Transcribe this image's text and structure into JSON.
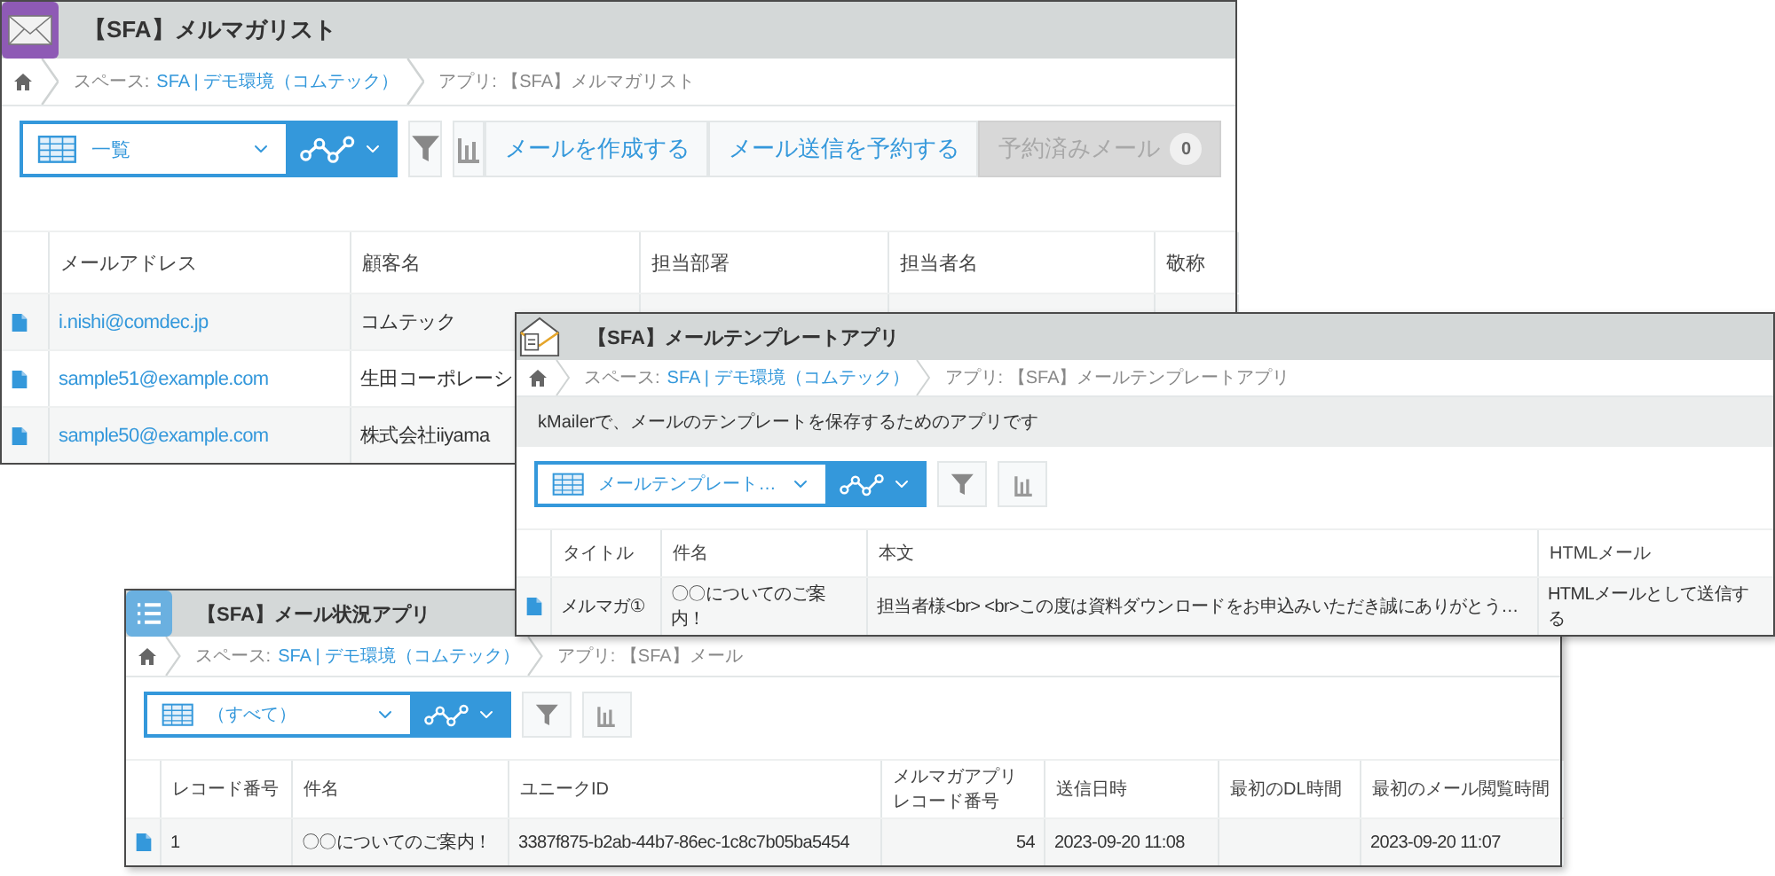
{
  "windows": [
    {
      "title": "【SFA】メルマガリスト",
      "breadcrumb": {
        "space_label": "スペース:",
        "space": "SFA | デモ環境（コムテック）",
        "app": "アプリ: 【SFA】メルマガリスト"
      },
      "view": "一覧",
      "buttons": [
        {
          "label": "メールを作成する",
          "disabled": false
        },
        {
          "label": "メール送信を予約する",
          "disabled": false
        },
        {
          "label": "予約済みメール",
          "count": "0",
          "disabled": true
        }
      ],
      "table": {
        "columns": [
          {
            "label": "メールアドレス",
            "kind": "link"
          },
          {
            "label": "顧客名",
            "kind": "text"
          },
          {
            "label": "担当部署",
            "kind": "text"
          },
          {
            "label": "担当者名",
            "kind": "text"
          },
          {
            "label": "敬称",
            "kind": "text"
          }
        ],
        "rows": [
          {
            "cells": [
              "i.nishi@comdec.jp",
              "コムテック"
            ]
          },
          {
            "cells": [
              "sample51@example.com",
              "生田コーポレーシ"
            ]
          },
          {
            "cells": [
              "sample50@example.com",
              "株式会社iiyama"
            ]
          }
        ]
      }
    },
    {
      "title": "【SFA】メールテンプレートアプリ",
      "breadcrumb": {
        "space_label": "スペース:",
        "space": "SFA | デモ環境（コムテック）",
        "app": "アプリ: 【SFA】メールテンプレートアプリ"
      },
      "description": "kMailerで、メールのテンプレートを保存するためのアプリです",
      "view": "メールテンプレート…",
      "table": {
        "columns": [
          {
            "label": "タイトル",
            "kind": "text"
          },
          {
            "label": "件名",
            "kind": "text"
          },
          {
            "label": "本文",
            "kind": "text"
          },
          {
            "label": "HTMLメール",
            "kind": "text"
          }
        ],
        "rows": [
          {
            "cells": [
              "メルマガ①",
              "〇〇についてのご案内！",
              "担当者様<br> <br>この度は資料ダウンロードをお申込みいただき誠にありがとう…",
              "HTMLメールとして送信する"
            ]
          }
        ]
      }
    },
    {
      "title": "【SFA】メール状況アプリ",
      "breadcrumb": {
        "space_label": "スペース:",
        "space": "SFA | デモ環境（コムテック）",
        "app": "アプリ: 【SFA】メール"
      },
      "view": "（すべて）",
      "table": {
        "columns": [
          {
            "label": "レコード番号",
            "kind": "text"
          },
          {
            "label": "件名",
            "kind": "text"
          },
          {
            "label": "ユニークID",
            "kind": "text"
          },
          {
            "label": "メルマガアプリレコード番号",
            "kind": "number"
          },
          {
            "label": "送信日時",
            "kind": "text"
          },
          {
            "label": "最初のDL時間",
            "kind": "text"
          },
          {
            "label": "最初のメール閲覧時間",
            "kind": "text"
          }
        ],
        "rows": [
          {
            "cells": [
              "1",
              "〇〇についてのご案内！",
              "3387f875-b2ab-44b7-86ec-1c8c7b05ba5454",
              "54",
              "2023-09-20 11:08",
              "",
              "2023-09-20 11:07"
            ]
          }
        ]
      }
    }
  ]
}
